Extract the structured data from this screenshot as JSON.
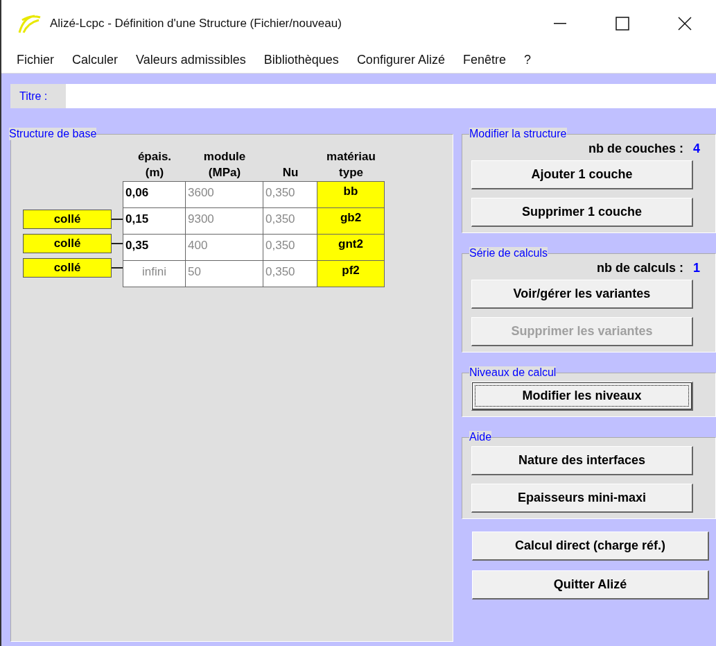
{
  "window": {
    "title": "Alizé-Lcpc - Définition d'une Structure (Fichier/nouveau)"
  },
  "menu": [
    "Fichier",
    "Calculer",
    "Valeurs admissibles",
    "Bibliothèques",
    "Configurer Alizé",
    "Fenêtre",
    "?"
  ],
  "title_field": {
    "label": "Titre :"
  },
  "base_structure": {
    "legend": "Structure de base",
    "columns": [
      "épais.\n(m)",
      "module\n(MPa)",
      "Nu",
      "matériau\ntype"
    ],
    "rows": [
      {
        "kind": "layer",
        "thickness": "0,06",
        "modulus": "3600",
        "nu": "0,350",
        "material": "bb"
      },
      {
        "kind": "layer",
        "thickness": "0,15",
        "modulus": "9300",
        "nu": "0,350",
        "material": "gb2"
      },
      {
        "kind": "layer",
        "thickness": "0,35",
        "modulus": "400",
        "nu": "0,350",
        "material": "gnt2"
      },
      {
        "kind": "substrate",
        "thickness": "infini",
        "modulus": "50",
        "nu": "0,350",
        "material": "pf2"
      }
    ],
    "interfaces": [
      "collé",
      "collé",
      "collé"
    ]
  },
  "groups": [
    {
      "legend": "Modifier la structure",
      "count_label": "nb de couches :",
      "count": "4",
      "buttons": [
        {
          "label": "Ajouter 1 couche",
          "disabled": false,
          "focused": false
        },
        {
          "label": "Supprimer 1 couche",
          "disabled": false,
          "focused": false
        }
      ]
    },
    {
      "legend": "Série de calculs",
      "count_label": "nb de calculs :",
      "count": "1",
      "buttons": [
        {
          "label": "Voir/gérer les variantes",
          "disabled": false,
          "focused": false
        },
        {
          "label": "Supprimer les variantes",
          "disabled": true,
          "focused": false
        }
      ]
    },
    {
      "legend": "Niveaux de calcul",
      "buttons": [
        {
          "label": "Modifier les niveaux",
          "disabled": false,
          "focused": true
        }
      ]
    },
    {
      "legend": "Aide",
      "buttons": [
        {
          "label": "Nature des interfaces",
          "disabled": false,
          "focused": false
        },
        {
          "label": "Epaisseurs mini-maxi",
          "disabled": false,
          "focused": false
        }
      ]
    }
  ],
  "actions": [
    {
      "label": "Calcul direct (charge réf.)",
      "disabled": false,
      "focused": false
    },
    {
      "label": "Quitter Alizé",
      "disabled": false,
      "focused": false
    }
  ]
}
